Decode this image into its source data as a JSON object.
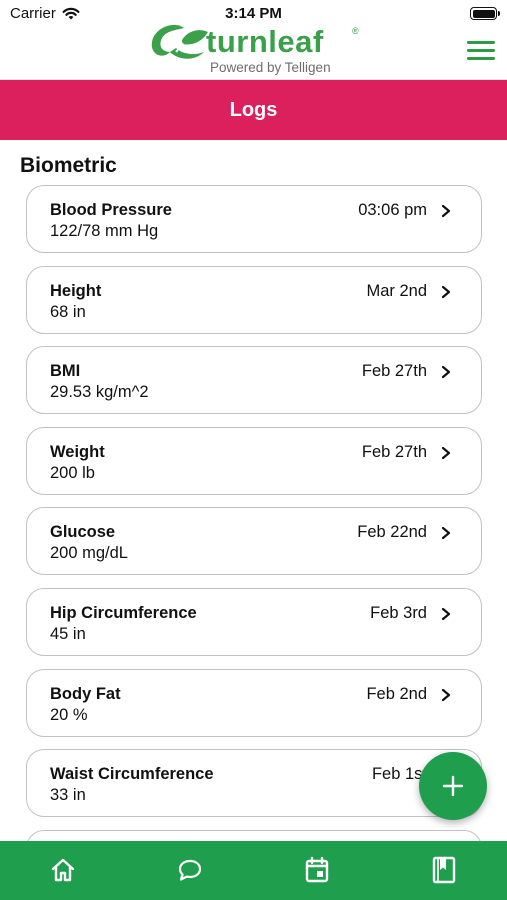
{
  "status_bar": {
    "carrier": "Carrier",
    "time": "3:14 PM"
  },
  "header": {
    "logo_text": "turnleaf",
    "logo_registered": "®",
    "logo_tagline": "Powered by Telligen",
    "menu_icon": "hamburger-menu-icon"
  },
  "page": {
    "title": "Logs"
  },
  "section": {
    "heading": "Biometric"
  },
  "logs": [
    {
      "name": "Blood Pressure",
      "value": "122/78 mm Hg",
      "date": "03:06 pm"
    },
    {
      "name": "Height",
      "value": "68 in",
      "date": "Mar 2nd"
    },
    {
      "name": "BMI",
      "value": "29.53 kg/m^2",
      "date": "Feb 27th"
    },
    {
      "name": "Weight",
      "value": "200 lb",
      "date": "Feb 27th"
    },
    {
      "name": "Glucose",
      "value": "200 mg/dL",
      "date": "Feb 22nd"
    },
    {
      "name": "Hip Circumference",
      "value": "45 in",
      "date": "Feb 3rd"
    },
    {
      "name": "Body Fat",
      "value": "20 %",
      "date": "Feb 2nd"
    },
    {
      "name": "Waist Circumference",
      "value": "33 in",
      "date": "Feb 1st"
    },
    {
      "name": "",
      "value": "",
      "date": ""
    }
  ],
  "fab": {
    "icon": "plus-icon"
  },
  "tabs": [
    {
      "icon": "home-icon"
    },
    {
      "icon": "chat-bubble-icon"
    },
    {
      "icon": "calendar-icon"
    },
    {
      "icon": "journal-icon"
    }
  ],
  "colors": {
    "brand_green": "#1f9e4d",
    "title_bar": "#dc1f5d",
    "card_border": "#c2c2c2"
  }
}
